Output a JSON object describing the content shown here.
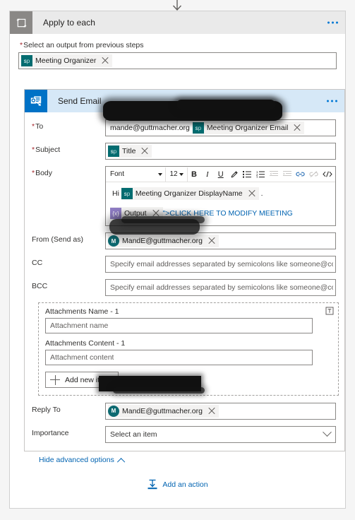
{
  "canvas": {
    "connector_arrow_icon": "down-arrow-icon"
  },
  "loop": {
    "title": "Apply to each",
    "icon": "loop-icon",
    "menu_icon": "ellipsis-icon",
    "output_field": {
      "label": "Select an output from previous steps",
      "required": true,
      "token": {
        "label": "Meeting Organizer",
        "icon": "sharepoint-token-icon",
        "remove_icon": "close-icon"
      }
    }
  },
  "action": {
    "title": "Send Email",
    "icon": "outlook-send-email-icon",
    "menu_icon": "ellipsis-icon",
    "fields": {
      "to": {
        "label": "To",
        "required": true,
        "value_text": "mande@guttmacher.org",
        "token": {
          "label": "Meeting Organizer Email",
          "icon": "sharepoint-token-icon",
          "remove_icon": "close-icon"
        },
        "redacted": true
      },
      "subject": {
        "label": "Subject",
        "required": true,
        "token": {
          "label": "Title",
          "icon": "sharepoint-token-icon",
          "remove_icon": "close-icon"
        }
      },
      "body": {
        "label": "Body",
        "required": true,
        "toolbar": {
          "font_label": "Font",
          "font_caret_icon": "chevron-down-icon",
          "size_label": "12",
          "size_caret_icon": "chevron-down-icon",
          "bold_label": "B",
          "italic_label": "I",
          "underline_label": "U",
          "highlight_icon": "pen-highlight-icon",
          "bullet_list_icon": "bulleted-list-icon",
          "numbered_list_icon": "numbered-list-icon",
          "outdent_icon": "outdent-icon",
          "indent_icon": "indent-icon",
          "link_icon": "insert-link-icon",
          "unlink_icon": "remove-link-icon",
          "code_icon": "code-view-icon"
        },
        "content": {
          "line1_prefix": "Hi",
          "line1_token": {
            "label": "Meeting Organizer DisplayName",
            "icon": "sharepoint-token-icon",
            "remove_icon": "close-icon"
          },
          "line1_suffix": ".",
          "line2_token": {
            "label": "Output",
            "icon": "expression-token-icon",
            "remove_icon": "close-icon"
          },
          "line2_text": "\">CLICK HERE TO MODIFY MEETING"
        }
      },
      "from": {
        "label": "From (Send as)",
        "token": {
          "label": "MandE@guttmacher.org",
          "icon": "person-avatar-icon",
          "avatar_initial": "M",
          "remove_icon": "close-icon"
        },
        "redacted": true
      },
      "cc": {
        "label": "CC",
        "placeholder": "Specify email addresses separated by semicolons like someone@contoso.com"
      },
      "bcc": {
        "label": "BCC",
        "placeholder": "Specify email addresses separated by semicolons like someone@contoso.com"
      },
      "attachments": {
        "delete_icon": "delete-attachment-icon",
        "name_label": "Attachments Name - 1",
        "name_placeholder": "Attachment name",
        "content_label": "Attachments Content - 1",
        "content_placeholder": "Attachment content",
        "add_item_label": "Add new item",
        "add_item_icon": "plus-icon"
      },
      "reply_to": {
        "label": "Reply To",
        "token": {
          "label": "MandE@guttmacher.org",
          "icon": "person-avatar-icon",
          "avatar_initial": "M",
          "remove_icon": "close-icon"
        },
        "redacted": true
      },
      "importance": {
        "label": "Importance",
        "selected": "Select an item",
        "chevron_icon": "chevron-down-icon"
      }
    },
    "advanced_toggle": {
      "label": "Hide advanced options",
      "icon": "chevron-up-icon"
    }
  },
  "footer": {
    "add_action_label": "Add an action",
    "add_action_icon": "add-action-icon"
  },
  "colors": {
    "accent_blue": "#0063b1",
    "action_header": "#d6e8f7",
    "action_icon_bg": "#0072c6",
    "loop_header": "#eaeaea",
    "loop_icon_bg": "#8a8886",
    "sharepoint_token": "#036c70",
    "expression_token": "#8e7cc3",
    "required_star": "#a4262c"
  }
}
